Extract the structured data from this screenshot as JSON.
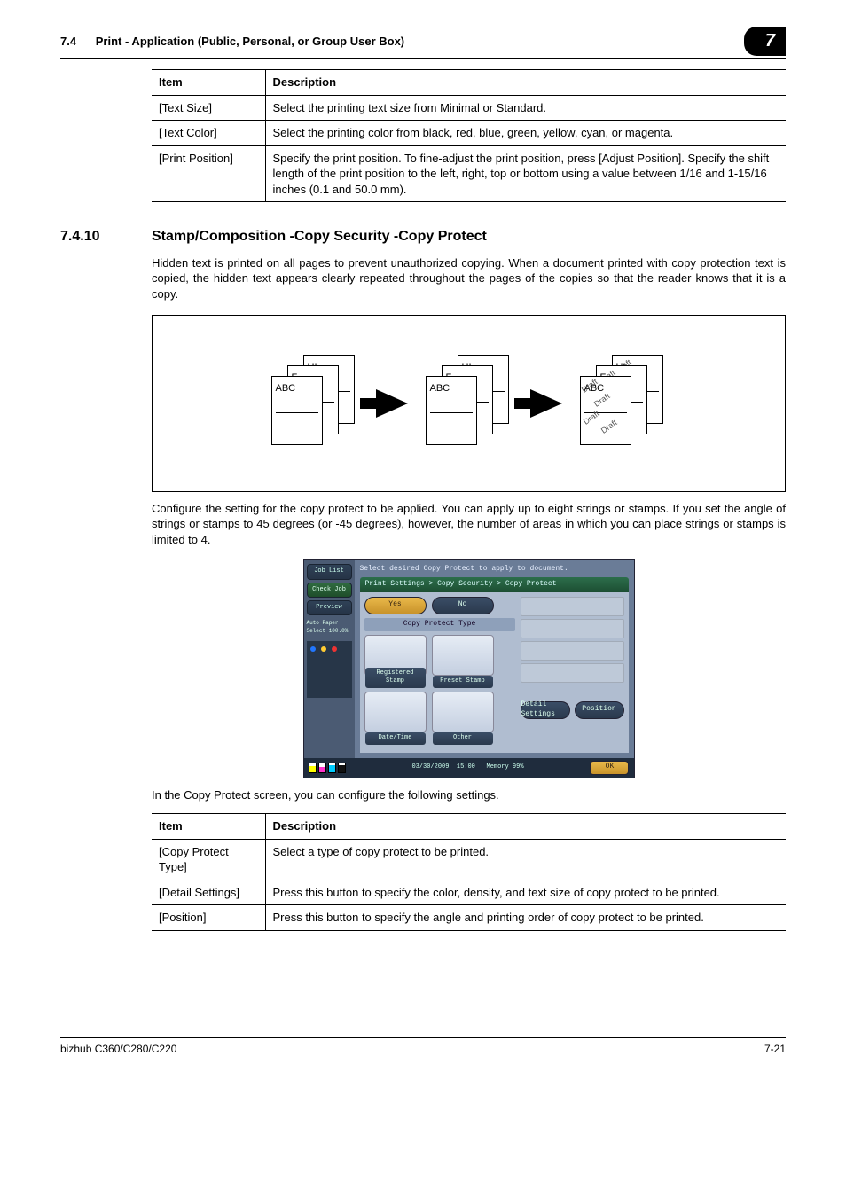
{
  "header": {
    "section_no": "7.4",
    "section_title": "Print - Application (Public, Personal, or Group User Box)",
    "chapter_badge": "7"
  },
  "table1": {
    "head_item": "Item",
    "head_desc": "Description",
    "rows": [
      {
        "item": "[Text Size]",
        "desc": "Select the printing text size from Minimal or Standard."
      },
      {
        "item": "[Text Color]",
        "desc": "Select the printing color from black, red, blue, green, yellow, cyan, or magenta."
      },
      {
        "item": "[Print Position]",
        "desc": "Specify the print position. To fine-adjust the print position, press [Adjust Position]. Specify the shift length of the print position to the left, right, top or bottom using a value between 1/16 and 1-15/16 inches (0.1 and 50.0 mm)."
      }
    ]
  },
  "section": {
    "number": "7.4.10",
    "title": "Stamp/Composition -Copy Security -Copy Protect",
    "para1": "Hidden text is printed on all pages to prevent unauthorized copying. When a document printed with copy protection text is copied, the hidden text appears clearly repeated throughout the pages of the copies so that the reader knows that it is a copy.",
    "para2": "Configure the setting for the copy protect to be applied. You can apply up to eight strings or stamps. If you set the angle of strings or stamps to 45 degrees (or -45 degrees), however, the number of areas in which you can place strings or stamps is limited to 4.",
    "para3": "In the Copy Protect screen, you can configure the following settings."
  },
  "diagram": {
    "sheet_texts": [
      "ABC",
      "F",
      "HI"
    ],
    "draft_word": "Draft"
  },
  "ui": {
    "left": {
      "job_list": "Job List",
      "check_job": "Check Job",
      "preview": "Preview",
      "paper": "Auto Paper Select  100.0%"
    },
    "instr": "Select desired Copy Protect to apply to document.",
    "crumb": "Print Settings > Copy Security > Copy Protect",
    "yes": "Yes",
    "no": "No",
    "type_label": "Copy Protect Type",
    "opts": {
      "registered_stamp": "Registered Stamp",
      "preset_stamp": "Preset Stamp",
      "date_time": "Date/Time",
      "other": "Other"
    },
    "detail_settings": "Detail Settings",
    "position": "Position",
    "ok": "OK",
    "status_date": "03/30/2009",
    "status_time": "15:00",
    "status_mem": "Memory",
    "status_mem_val": "99%"
  },
  "table2": {
    "head_item": "Item",
    "head_desc": "Description",
    "rows": [
      {
        "item": "[Copy Protect Type]",
        "desc": "Select a type of copy protect to be printed."
      },
      {
        "item": "[Detail Settings]",
        "desc": "Press this button to specify the color, density, and text size of copy protect to be printed."
      },
      {
        "item": "[Position]",
        "desc": "Press this button to specify the angle and printing order of copy protect to be printed."
      }
    ]
  },
  "footer": {
    "left": "bizhub C360/C280/C220",
    "right": "7-21"
  }
}
